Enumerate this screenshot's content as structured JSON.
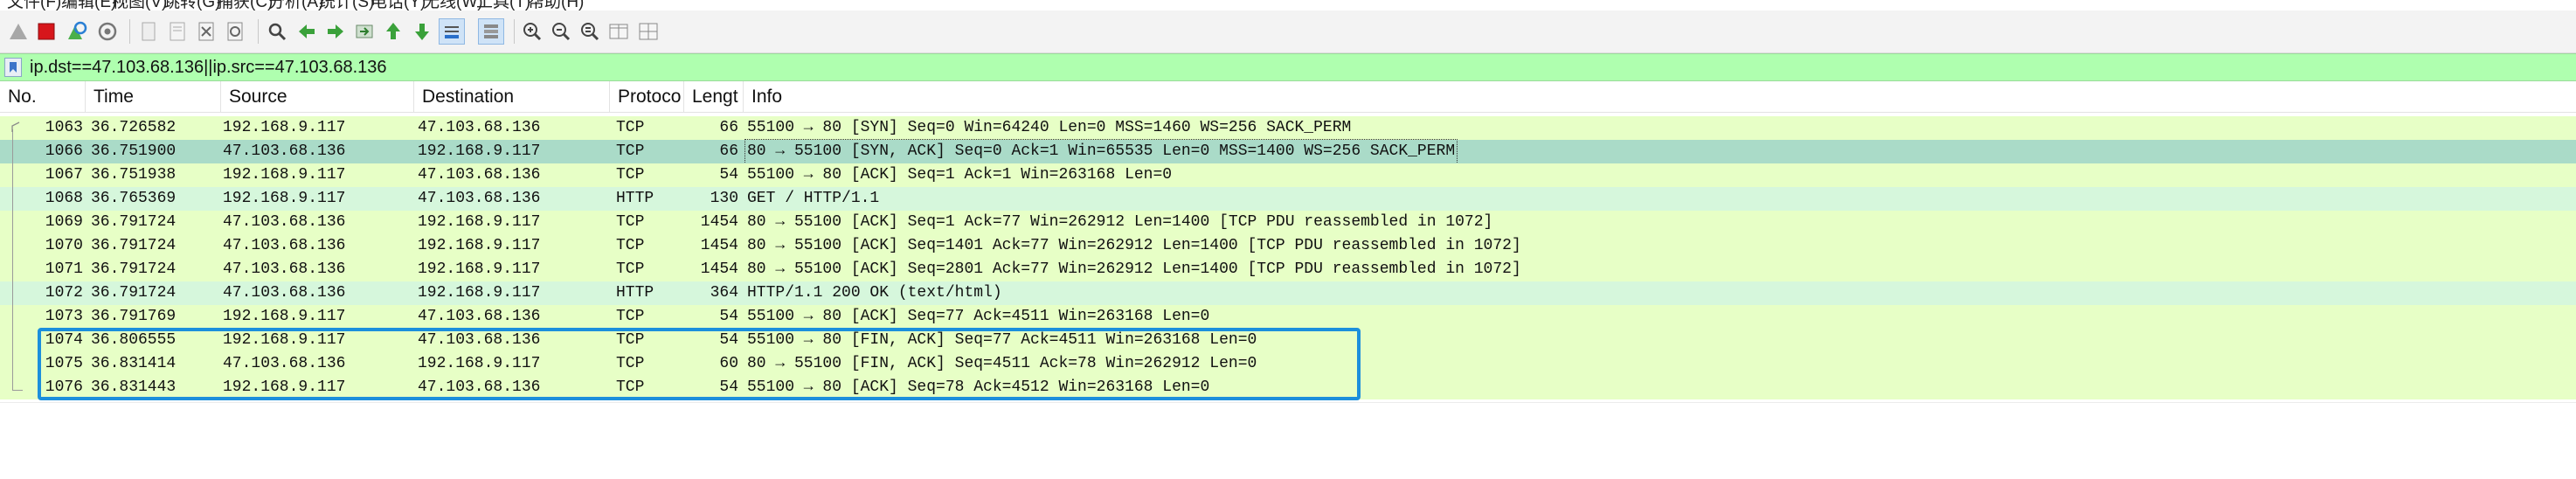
{
  "menu": [
    "文件(F)",
    "编辑(E)",
    "视图(V)",
    "跳转(G)",
    "捕获(C)",
    "分析(A)",
    "统计(S)",
    "电话(Y)",
    "无线(W)",
    "工具(T)",
    "帮助(H)"
  ],
  "toolbar": {
    "icons": [
      "shark-fin-start-icon",
      "stop-capture-icon",
      "restart-capture-icon",
      "capture-options-icon",
      "open-file-icon",
      "save-file-icon",
      "close-file-icon",
      "reload-file-icon",
      "find-packet-icon",
      "go-back-icon",
      "go-forward-icon",
      "go-to-packet-icon",
      "go-first-icon",
      "go-last-icon",
      "auto-scroll-icon",
      "colorize-icon",
      "zoom-in-icon",
      "zoom-out-icon",
      "zoom-normal-icon",
      "resize-columns-icon",
      "layout-icon"
    ]
  },
  "filter": {
    "value": "ip.dst==47.103.68.136||ip.src==47.103.68.136",
    "bg_color": "#afffaf"
  },
  "columns": {
    "no": "No.",
    "time": "Time",
    "source": "Source",
    "destination": "Destination",
    "protocol": "Protoco",
    "length": "Lengt",
    "info": "Info"
  },
  "packets": [
    {
      "no": "1063",
      "time": "36.726582",
      "source": "192.168.9.117",
      "destination": "47.103.68.136",
      "protocol": "TCP",
      "length": "66",
      "info": "55100 → 80 [SYN] Seq=0 Win=64240 Len=0 MSS=1460 WS=256 SACK_PERM",
      "color": "#e7ffc6"
    },
    {
      "no": "1066",
      "time": "36.751900",
      "source": "47.103.68.136",
      "destination": "192.168.9.117",
      "protocol": "TCP",
      "length": "66",
      "info": "80 → 55100 [SYN, ACK] Seq=0 Ack=1 Win=65535 Len=0 MSS=1400 WS=256 SACK_PERM",
      "color": "#aadbc8",
      "selected": true
    },
    {
      "no": "1067",
      "time": "36.751938",
      "source": "192.168.9.117",
      "destination": "47.103.68.136",
      "protocol": "TCP",
      "length": "54",
      "info": "55100 → 80 [ACK] Seq=1 Ack=1 Win=263168 Len=0",
      "color": "#e7ffc6"
    },
    {
      "no": "1068",
      "time": "36.765369",
      "source": "192.168.9.117",
      "destination": "47.103.68.136",
      "protocol": "HTTP",
      "length": "130",
      "info": "GET / HTTP/1.1",
      "color": "#d6f7dc"
    },
    {
      "no": "1069",
      "time": "36.791724",
      "source": "47.103.68.136",
      "destination": "192.168.9.117",
      "protocol": "TCP",
      "length": "1454",
      "info": "80 → 55100 [ACK] Seq=1 Ack=77 Win=262912 Len=1400 [TCP PDU reassembled in 1072]",
      "color": "#e7ffc6"
    },
    {
      "no": "1070",
      "time": "36.791724",
      "source": "47.103.68.136",
      "destination": "192.168.9.117",
      "protocol": "TCP",
      "length": "1454",
      "info": "80 → 55100 [ACK] Seq=1401 Ack=77 Win=262912 Len=1400 [TCP PDU reassembled in 1072]",
      "color": "#e7ffc6"
    },
    {
      "no": "1071",
      "time": "36.791724",
      "source": "47.103.68.136",
      "destination": "192.168.9.117",
      "protocol": "TCP",
      "length": "1454",
      "info": "80 → 55100 [ACK] Seq=2801 Ack=77 Win=262912 Len=1400 [TCP PDU reassembled in 1072]",
      "color": "#e7ffc6"
    },
    {
      "no": "1072",
      "time": "36.791724",
      "source": "47.103.68.136",
      "destination": "192.168.9.117",
      "protocol": "HTTP",
      "length": "364",
      "info": "HTTP/1.1 200 OK  (text/html)",
      "color": "#d6f7dc"
    },
    {
      "no": "1073",
      "time": "36.791769",
      "source": "192.168.9.117",
      "destination": "47.103.68.136",
      "protocol": "TCP",
      "length": "54",
      "info": "55100 → 80 [ACK] Seq=77 Ack=4511 Win=263168 Len=0",
      "color": "#e7ffc6"
    },
    {
      "no": "1074",
      "time": "36.806555",
      "source": "192.168.9.117",
      "destination": "47.103.68.136",
      "protocol": "TCP",
      "length": "54",
      "info": "55100 → 80 [FIN, ACK] Seq=77 Ack=4511 Win=263168 Len=0",
      "color": "#e7ffc6"
    },
    {
      "no": "1075",
      "time": "36.831414",
      "source": "47.103.68.136",
      "destination": "192.168.9.117",
      "protocol": "TCP",
      "length": "60",
      "info": "80 → 55100 [FIN, ACK] Seq=4511 Ack=78 Win=262912 Len=0",
      "color": "#e7ffc6"
    },
    {
      "no": "1076",
      "time": "36.831443",
      "source": "192.168.9.117",
      "destination": "47.103.68.136",
      "protocol": "TCP",
      "length": "54",
      "info": "55100 → 80 [ACK] Seq=78 Ack=4512 Win=263168 Len=0",
      "color": "#e7ffc6"
    }
  ],
  "highlight_color": "#1c8fdc"
}
